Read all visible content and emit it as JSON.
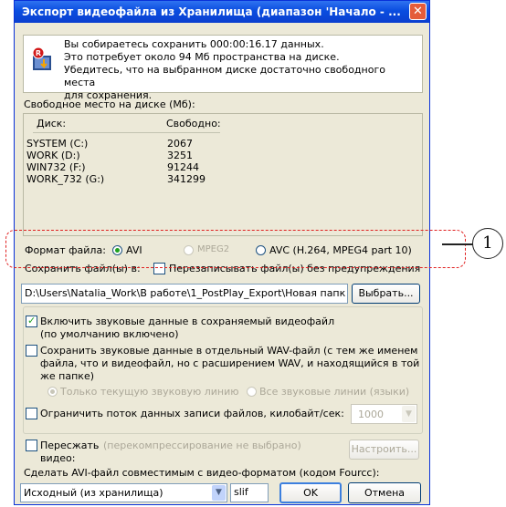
{
  "dialog": {
    "title": "Экспорт видеофайла из Хранилища (диапазон 'Начало - ...",
    "close_symbol": "✕"
  },
  "info": {
    "icon": "export-video-icon",
    "lines": [
      "Вы собираетесь сохранить 000:00:16.17 данных.",
      "Это потребует около 94 Мб пространства на диске.",
      "Убедитесь, что на выбранном диске достаточно свободного места",
      "для сохранения."
    ]
  },
  "disk_space": {
    "label": "Свободное место на диске (Мб):",
    "col_disk": "Диск:",
    "col_free": "Свободно:",
    "rows": [
      {
        "disk": "SYSTEM (C:)",
        "free": "2067"
      },
      {
        "disk": "WORK (D:)",
        "free": "3251"
      },
      {
        "disk": "WIN732 (F:)",
        "free": "91244"
      },
      {
        "disk": "WORK_732 (G:)",
        "free": "341299"
      }
    ]
  },
  "format": {
    "label": "Формат файла:",
    "options": [
      {
        "label": "AVI",
        "selected": true,
        "enabled": true
      },
      {
        "label": "MPEG2",
        "selected": false,
        "enabled": false
      },
      {
        "label": "AVC (H.264, MPEG4 part 10)",
        "selected": false,
        "enabled": true
      }
    ]
  },
  "save": {
    "label": "Сохранить файл(ы) в:",
    "overwrite_label": "Перезаписывать файл(ы) без предупреждения",
    "overwrite_checked": false,
    "path_value": "D:\\Users\\Natalia_Work\\В работе\\1_PostPlay_Export\\Новая папк",
    "browse_label": "Выбрать..."
  },
  "audio": {
    "include_label_1": "Включить звуковые данные в сохраняемый видеофайл",
    "include_label_2": "(по умолчанию включено)",
    "include_checked": true,
    "separate_label_1": "Сохранить звуковые данные в отдельный WAV-файл (с тем же именем",
    "separate_label_2": "файла, что и видеофайл, но с расширением WAV, и находящийся в той",
    "separate_label_3": "же папке)",
    "separate_checked": false,
    "track_current": "Только текущую звуковую линию",
    "track_all": "Все звуковые линии (языки)",
    "limit_label": "Ограничить поток данных записи файлов, килобайт/сек:",
    "limit_checked": false,
    "limit_value": "1000"
  },
  "recompress": {
    "label_1": "Пересжать",
    "label_2": "видео:",
    "checked": false,
    "status": "(перекомпрессирование не выбрано)",
    "configure_label": "Настроить..."
  },
  "fourcc": {
    "label": "Сделать AVI-файл совместимым с видео-форматом (кодом Fourcc):",
    "selected": "Исходный (из хранилища)",
    "code": "slif"
  },
  "buttons": {
    "ok": "OK",
    "cancel": "Отмена"
  },
  "callout": {
    "number": "1"
  },
  "colors": {
    "titlebar": "#0a4de0",
    "dialog_bg": "#ece9d8",
    "annotation_red": "#e02020",
    "check_green": "#21a121"
  }
}
